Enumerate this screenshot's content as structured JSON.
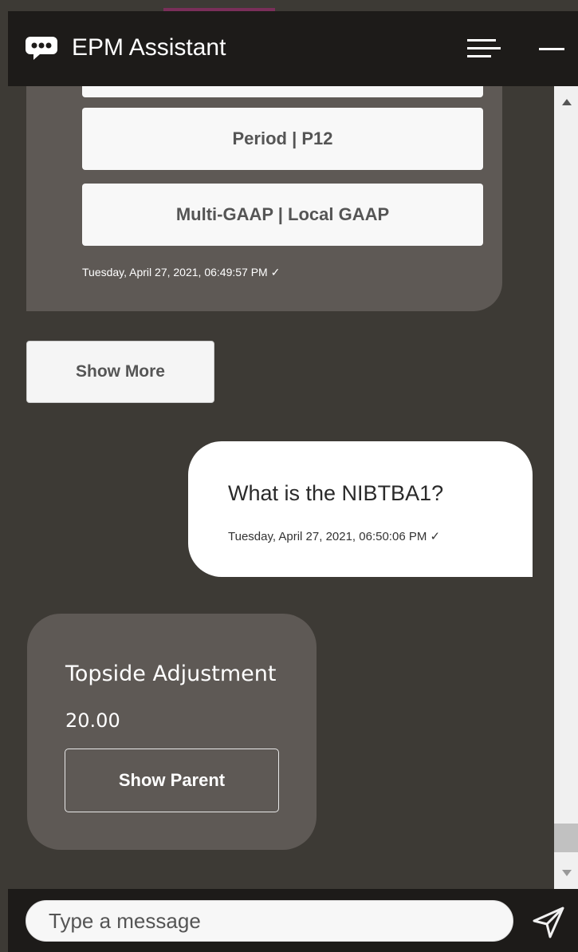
{
  "header": {
    "title": "EPM Assistant",
    "icons": {
      "logo": "speech-bubble-icon",
      "menu": "hamburger-menu-icon",
      "minimize": "minimize-icon"
    }
  },
  "conversation": {
    "bot_options": {
      "buttons": [
        "Period | P12",
        "Multi-GAAP | Local GAAP"
      ],
      "timestamp": "Tuesday, April 27, 2021, 06:49:57 PM ✓"
    },
    "show_more_label": "Show More",
    "user_message": {
      "text": "What is the NIBTBA1?",
      "timestamp": "Tuesday, April 27, 2021, 06:50:06 PM ✓"
    },
    "bot_reply": {
      "title": "Topside Adjustment",
      "value": "20.00",
      "button_label": "Show Parent"
    }
  },
  "composer": {
    "placeholder": "Type a message",
    "send_icon": "send-icon"
  },
  "colors": {
    "header_bg": "#1d1b19",
    "chat_bg": "#3d3a35",
    "bot_bubble": "#5e5955",
    "user_bubble": "#ffffff"
  }
}
